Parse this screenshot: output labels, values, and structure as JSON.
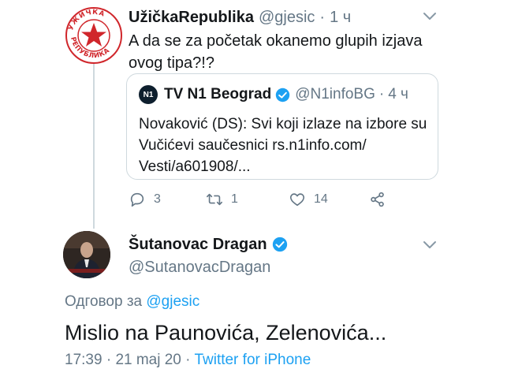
{
  "colors": {
    "accent": "#1da1f2",
    "secondary_text": "#657786",
    "primary_text": "#14171a",
    "border": "#cfd9de",
    "logo_red": "#d0262b"
  },
  "tweet1": {
    "avatar_icon": "uzicka-republika-logo",
    "avatar_logo_text": "УЖИЧКА РЕПУБЛИКА",
    "name": "UžičkaRepublika",
    "handle": "@gjesic",
    "separator": "·",
    "time": "1 ч",
    "text": "A da se za početak okanemo glupih izjava ovog tipa?!?",
    "menu_icon": "chevron-down-icon"
  },
  "quote": {
    "avatar_text": "N1",
    "name": "TV N1 Beograd",
    "verified_icon": "verified-badge-icon",
    "handle": "@N1infoBG",
    "separator": "·",
    "time": "4 ч",
    "text": "Novaković (DS): Svi koji izlaze na izbore su Vučićevi saučesnici rs.n1info.com/ Vesti/a601908/..."
  },
  "actions": {
    "reply": {
      "icon": "reply-icon",
      "count": "3"
    },
    "retweet": {
      "icon": "retweet-icon",
      "count": "1"
    },
    "like": {
      "icon": "heart-icon",
      "count": "14"
    },
    "share": {
      "icon": "share-icon"
    }
  },
  "tweet2": {
    "avatar_icon": "profile-photo",
    "name": "Šutanovac Dragan",
    "verified_icon": "verified-badge-icon",
    "handle": "@SutanovacDragan",
    "menu_icon": "chevron-down-icon",
    "reply_prefix": "Одговор за ",
    "reply_mention": "@gjesic",
    "text": "Mislio na Paunovića, Zelenovića...",
    "time": "17:39",
    "separator": "·",
    "date": "21 maj 20",
    "source": "Twitter for iPhone"
  }
}
